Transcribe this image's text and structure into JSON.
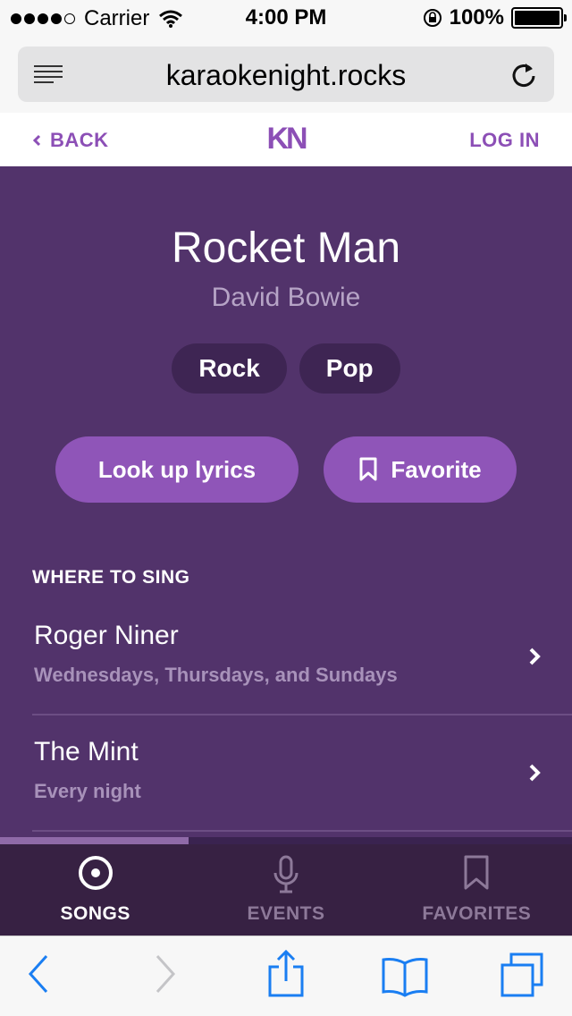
{
  "status_bar": {
    "carrier": "Carrier",
    "time": "4:00 PM",
    "battery": "100%",
    "battery_level": 1.0
  },
  "address_bar": {
    "url": "karaokenight.rocks"
  },
  "site_nav": {
    "back_label": "BACK",
    "logo": "KN",
    "login_label": "LOG IN"
  },
  "song": {
    "title": "Rocket Man",
    "artist": "David Bowie",
    "genres": [
      "Rock",
      "Pop"
    ],
    "lyrics_label": "Look up lyrics",
    "favorite_label": "Favorite"
  },
  "where_to_sing": {
    "heading": "WHERE TO SING",
    "venues": [
      {
        "name": "Roger Niner",
        "schedule": "Wednesdays, Thursdays, and Sundays"
      },
      {
        "name": "The Mint",
        "schedule": "Every night"
      }
    ]
  },
  "scroll_progress": 0.33,
  "tab_bar": {
    "tabs": [
      {
        "label": "SONGS",
        "icon": "disc-icon",
        "active": true
      },
      {
        "label": "EVENTS",
        "icon": "microphone-icon",
        "active": false
      },
      {
        "label": "FAVORITES",
        "icon": "bookmark-icon",
        "active": false
      }
    ]
  },
  "colors": {
    "accent": "#8c4fb6",
    "background": "#52336b",
    "tab_bar": "#372143",
    "ios_blue": "#1a7ef2"
  }
}
